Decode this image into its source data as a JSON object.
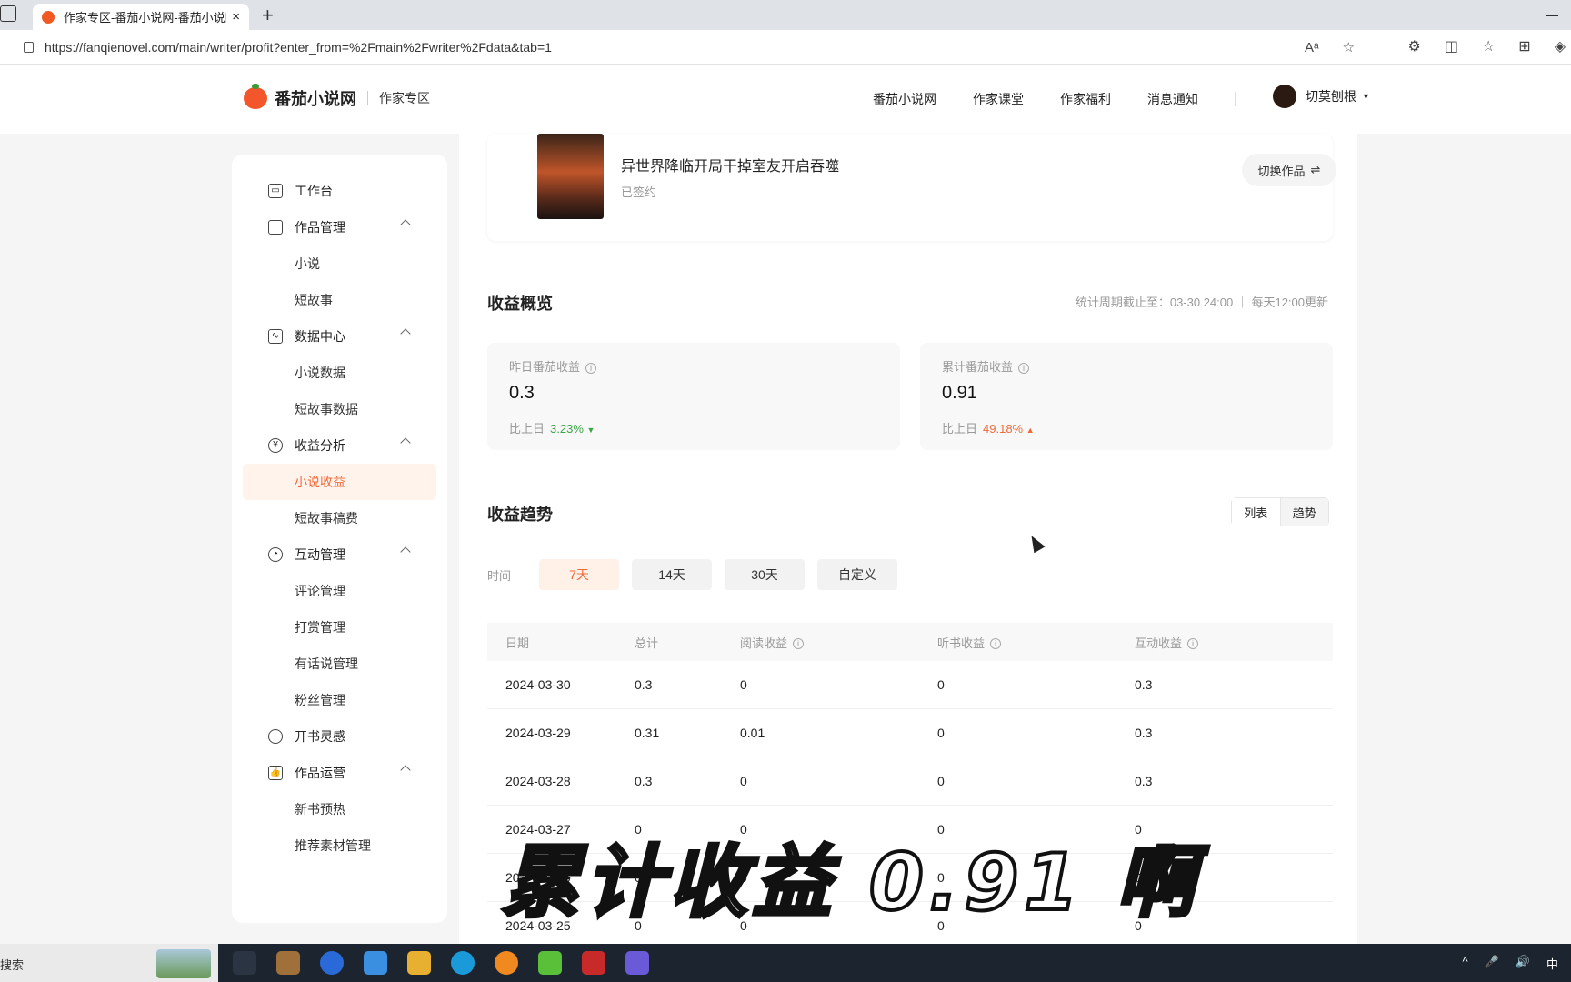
{
  "browser": {
    "tab_title": "作家专区-番茄小说网-番茄小说网",
    "tab_close": "×",
    "new_tab": "+",
    "minimize": "—",
    "url": "https://fanqienovel.com/main/writer/profit?enter_from=%2Fmain%2Fwriter%2Fdata&tab=1",
    "icons": [
      "read-aloud-icon",
      "favorite-star-icon",
      "extensions-icon",
      "split-screen-icon",
      "favorites-icon",
      "collections-icon",
      "copilot-icon"
    ]
  },
  "header": {
    "site_name": "番茄小说网",
    "section": "作家专区",
    "nav": [
      "番茄小说网",
      "作家课堂",
      "作家福利",
      "消息通知"
    ],
    "username": "切莫刨根"
  },
  "sidebar": {
    "items": [
      {
        "label": "工作台",
        "type": "group",
        "icon": "monitor-icon",
        "glyph": "▭",
        "chevron": false
      },
      {
        "label": "作品管理",
        "type": "group",
        "icon": "book-icon",
        "glyph": "",
        "chevron": true
      },
      {
        "label": "小说",
        "type": "sub"
      },
      {
        "label": "短故事",
        "type": "sub"
      },
      {
        "label": "数据中心",
        "type": "group",
        "icon": "chart-monitor-icon",
        "glyph": "∿",
        "chevron": true
      },
      {
        "label": "小说数据",
        "type": "sub"
      },
      {
        "label": "短故事数据",
        "type": "sub"
      },
      {
        "label": "收益分析",
        "type": "group",
        "icon": "yen-circle-icon",
        "glyph": "¥",
        "chevron": true,
        "round": true
      },
      {
        "label": "小说收益",
        "type": "sub",
        "active": true
      },
      {
        "label": "短故事稿费",
        "type": "sub"
      },
      {
        "label": "互动管理",
        "type": "group",
        "icon": "interaction-icon",
        "glyph": "◔",
        "chevron": true,
        "round": true
      },
      {
        "label": "评论管理",
        "type": "sub"
      },
      {
        "label": "打赏管理",
        "type": "sub"
      },
      {
        "label": "有话说管理",
        "type": "sub"
      },
      {
        "label": "粉丝管理",
        "type": "sub"
      },
      {
        "label": "开书灵感",
        "type": "group",
        "icon": "lightbulb-icon",
        "glyph": "",
        "chevron": false,
        "round": true
      },
      {
        "label": "作品运营",
        "type": "group",
        "icon": "thumbs-up-icon",
        "glyph": "👍",
        "chevron": true
      },
      {
        "label": "新书预热",
        "type": "sub"
      },
      {
        "label": "推荐素材管理",
        "type": "sub"
      }
    ]
  },
  "book": {
    "title": "异世界降临开局干掉室友开启吞噬",
    "status": "已签约",
    "switch_label": "切换作品",
    "switch_icon": "⇌"
  },
  "overview": {
    "title": "收益概览",
    "note": "统计周期截止至：03-30 24:00 ｜ 每天12:00更新",
    "cards": [
      {
        "label": "昨日番茄收益",
        "value": "0.3",
        "compare_label": "比上日",
        "pct": "3.23%",
        "trend": "▼",
        "direction": "down"
      },
      {
        "label": "累计番茄收益",
        "value": "0.91",
        "compare_label": "比上日",
        "pct": "49.18%",
        "trend": "▲",
        "direction": "up"
      }
    ]
  },
  "trend": {
    "title": "收益趋势",
    "view_list": "列表",
    "view_trend": "趋势",
    "time_label": "时间",
    "ranges": [
      "7天",
      "14天",
      "30天",
      "自定义"
    ],
    "selected_range": "7天"
  },
  "table": {
    "headers": [
      "日期",
      "总计",
      "阅读收益",
      "听书收益",
      "互动收益"
    ],
    "rows": [
      [
        "2024-03-30",
        "0.3",
        "0",
        "0",
        "0.3"
      ],
      [
        "2024-03-29",
        "0.31",
        "0.01",
        "0",
        "0.3"
      ],
      [
        "2024-03-28",
        "0.3",
        "0",
        "0",
        "0.3"
      ],
      [
        "2024-03-27",
        "0",
        "0",
        "0",
        "0"
      ],
      [
        "2024-03-26",
        "0",
        "0",
        "0",
        "0"
      ],
      [
        "2024-03-25",
        "0",
        "0",
        "0",
        "0"
      ]
    ]
  },
  "overlay_caption": "累计收益 0.91 啊",
  "taskbar": {
    "search_text": "搜索",
    "apps": [
      "task-view-icon",
      "archive-app-icon",
      "p-app-icon",
      "store-icon",
      "file-explorer-icon",
      "edge-icon",
      "orange-app-icon",
      "video-app-icon",
      "red-app-icon",
      "photos-icon"
    ],
    "tray": [
      "^",
      "🎤",
      "🔊",
      "中"
    ]
  },
  "colors": {
    "accent": "#f06a3a",
    "down": "#3aa646",
    "up": "#f06a3a"
  }
}
